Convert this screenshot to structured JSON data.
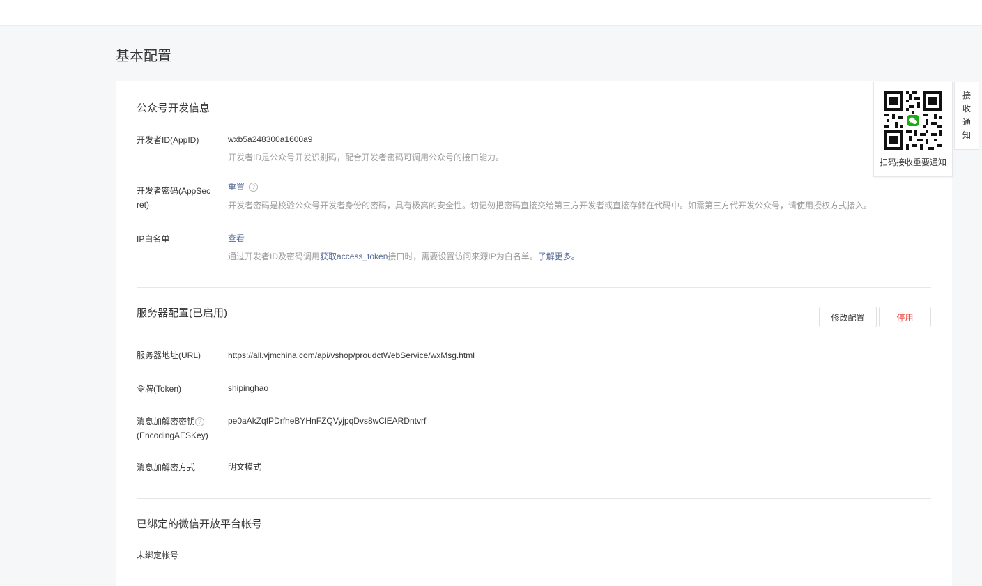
{
  "page": {
    "title": "基本配置"
  },
  "dev_info": {
    "title": "公众号开发信息",
    "appid": {
      "label": "开发者ID(AppID)",
      "value": "wxb5a248300a1600a9",
      "desc": "开发者ID是公众号开发识别码，配合开发者密码可调用公众号的接口能力。"
    },
    "appsecret": {
      "label_line1": "开发者密码(AppSec",
      "label_line2": "ret)",
      "action": "重置",
      "help_icon": "?",
      "desc": "开发者密码是校验公众号开发者身份的密码，具有极高的安全性。切记勿把密码直接交给第三方开发者或直接存储在代码中。如需第三方代开发公众号，请使用授权方式接入。"
    },
    "ip_whitelist": {
      "label": "IP白名单",
      "action": "查看",
      "desc_pre": "通过开发者ID及密码调用",
      "desc_link": "获取access_token",
      "desc_mid": "接口时，需要设置访问来源IP为白名单。",
      "desc_more": "了解更多。"
    }
  },
  "server": {
    "title": "服务器配置(已启用)",
    "modify_button": "修改配置",
    "disable_button": "停用",
    "url": {
      "label": "服务器地址(URL)",
      "value": "https://all.vjmchina.com/api/vshop/proudctWebService/wxMsg.html"
    },
    "token": {
      "label": "令牌(Token)",
      "value": "shipinghao"
    },
    "aeskey": {
      "label_line1": "消息加解密密钥",
      "label_line2": "(EncodingAESKey)",
      "help_icon": "?",
      "value": "pe0aAkZqfPDrfheBYHnFZQVyjpqDvs8wClEARDntvrf"
    },
    "mode": {
      "label": "消息加解密方式",
      "value": "明文模式"
    }
  },
  "open_platform": {
    "title": "已绑定的微信开放平台帐号",
    "status": "未绑定帐号"
  },
  "qr_popup": {
    "caption": "扫码接收重要通知",
    "icon": "wechat-qr-icon"
  },
  "side_tab": {
    "chars": [
      "接",
      "收",
      "通",
      "知"
    ]
  },
  "colors": {
    "link": "#576b95",
    "danger": "#e64340",
    "wechat_green": "#1aad19"
  }
}
